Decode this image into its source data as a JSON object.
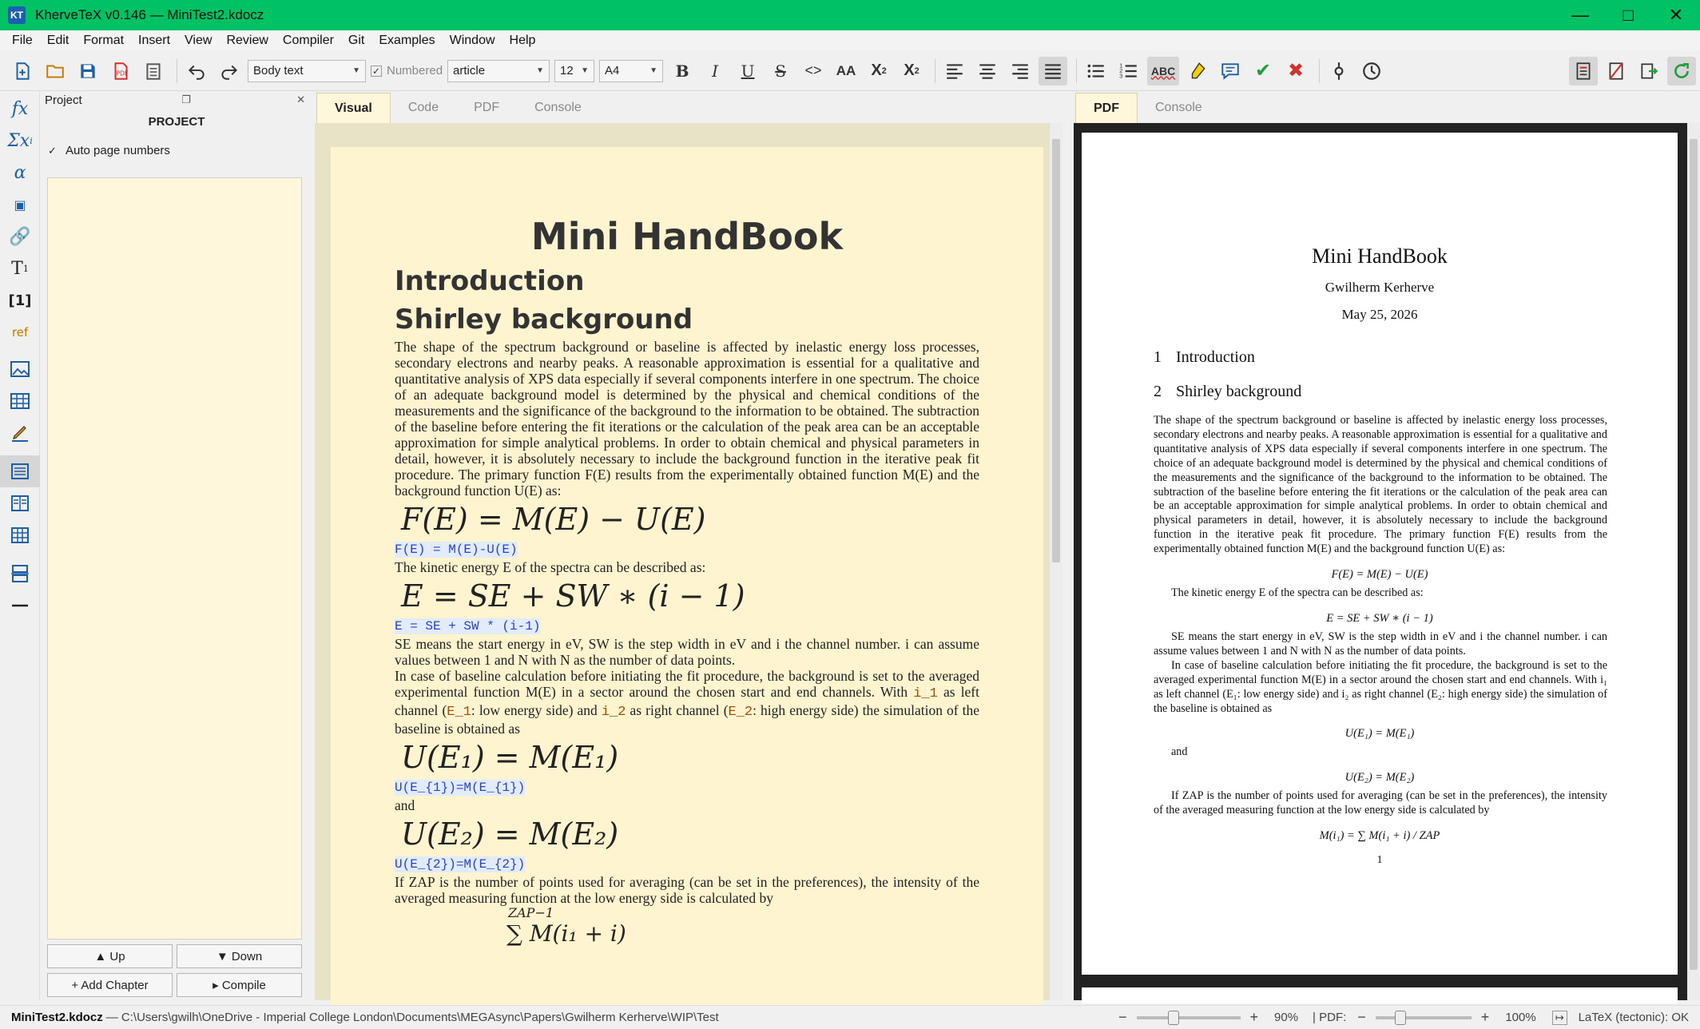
{
  "window": {
    "title": "KherveTeX v0.146 — MiniTest2.kdocz",
    "app_icon": "KT"
  },
  "menu": [
    "File",
    "Edit",
    "Format",
    "Insert",
    "View",
    "Review",
    "Compiler",
    "Git",
    "Examples",
    "Window",
    "Help"
  ],
  "toolbar": {
    "style_select": "Body text",
    "numbered_label": "Numbered",
    "doc_class": "article",
    "font_size": "12",
    "paper": "A4"
  },
  "project": {
    "header": "Project",
    "title": "PROJECT",
    "auto_page_numbers": "Auto page numbers",
    "up": "▲ Up",
    "down": "▼ Down",
    "add_chapter": "+ Add Chapter",
    "compile": "▸ Compile"
  },
  "editor": {
    "tabs": [
      "Visual",
      "Code",
      "PDF",
      "Console"
    ],
    "doc_title": "Mini HandBook",
    "h_intro": "Introduction",
    "h_shirley": "Shirley background",
    "p1": "The shape of the spectrum background or baseline is affected by inelastic energy loss processes, secondary electrons and nearby peaks. A reasonable approximation is essential for a qualitative and quantitative analysis of XPS data especially if several components interfere in one spectrum. The choice of an adequate background model is determined by the physical and chemical conditions of the measurements and the significance of the background to the information to be obtained. The subtraction of the baseline before entering the fit iterations or the calculation of the peak area can be an acceptable approximation for simple analytical problems. In order to obtain chemical and physical parameters in detail, however, it is absolutely necessary to include the background function in the iterative peak fit procedure. The primary function F(E) results from the experimentally obtained function M(E) and the background function U(E) as:",
    "eq1": "F(E) = M(E) − U(E)",
    "code1": "F(E) = M(E)-U(E)",
    "p2": "The kinetic energy E of the spectra can be described as:",
    "eq2": "E = SE + SW ∗ (i − 1)",
    "code2": "E = SE + SW * (i-1)",
    "p3": "SE means the start energy in eV, SW is the step width in eV and i the channel number. i can assume values between 1 and N with N as the number of data points.",
    "p4a": "In case of baseline calculation before initiating the fit procedure, the background is set to the averaged experimental function M(E) in a sector around the chosen start and end channels. With ",
    "p4_i1": "i_1",
    "p4b": " as left channel (",
    "p4_e1": "E_1",
    "p4c": ": low energy side) and ",
    "p4_i2": "i_2",
    "p4d": " as right channel (",
    "p4_e2": "E_2",
    "p4e": ": high energy side) the simulation of the baseline is obtained as",
    "eq3": "U(E₁) = M(E₁)",
    "code3": "U(E_{1})=M(E_{1})",
    "p5": "and",
    "eq4": "U(E₂) = M(E₂)",
    "code4": "U(E_{2})=M(E_{2})",
    "p6": "If ZAP is the number of points used for averaging (can be set in the preferences), the intensity of the averaged measuring function at the low energy side is calculated by",
    "sum_top": "ZAP−1",
    "sum_expr": "∑ M(i₁ + i)"
  },
  "pdf": {
    "tabs": [
      "PDF",
      "Console"
    ],
    "title": "Mini HandBook",
    "author": "Gwilherm Kerherve",
    "date": "May 25, 2026",
    "sec1_num": "1",
    "sec1": "Introduction",
    "sec2_num": "2",
    "sec2": "Shirley background",
    "p1": "The shape of the spectrum background or baseline is affected by inelastic energy loss processes, secondary electrons and nearby peaks. A reasonable approximation is essential for a qualitative and quantitative analysis of XPS data especially if several components interfere in one spectrum. The choice of an adequate background model is determined by the physical and chemical conditions of the measurements and the significance of the background to the information to be obtained. The subtraction of the baseline before entering the fit iterations or the calculation of the peak area can be an acceptable approximation for simple analytical problems. In order to obtain chemical and physical parameters in detail, however, it is absolutely necessary to include the background function in the iterative peak fit procedure. The primary function F(E) results from the experimentally obtained function M(E) and the background function U(E) as:",
    "eq1": "F(E) = M(E) − U(E)",
    "p2": "The kinetic energy E of the spectra can be described as:",
    "eq2": "E = SE + SW ∗ (i − 1)",
    "p3": "SE means the start energy in eV, SW is the step width in eV and i the channel number. i can assume values between 1 and N with N as the number of data points.",
    "p4": "In case of baseline calculation before initiating the fit procedure, the background is set to the averaged experimental function M(E) in a sector around the chosen start and end channels. With i₁ as left channel (E₁: low energy side) and i₂ as right channel (E₂: high energy side) the simulation of the baseline is obtained as",
    "eq3": "U(E₁) = M(E₁)",
    "p5": "and",
    "eq4": "U(E₂) = M(E₂)",
    "p6": "If ZAP is the number of points used for averaging (can be set in the preferences), the intensity of the averaged measuring function at the low energy side is calculated by",
    "eq5": "M(i₁) = ∑ M(i₁ + i) / ZAP",
    "page_num": "1"
  },
  "status": {
    "filename": "MiniTest2.kdocz",
    "path": " — C:\\Users\\gwilh\\OneDrive - Imperial College London\\Documents\\MEGAsync\\Papers\\Gwilherm Kerherve\\WIP\\Test",
    "zoom": "90%",
    "pdf_label": "| PDF:",
    "pdf_zoom": "100%",
    "latex_status": "LaTeX (tectonic): OK",
    "zoom_level": 0.3,
    "pdf_zoom_level": 0.2
  }
}
